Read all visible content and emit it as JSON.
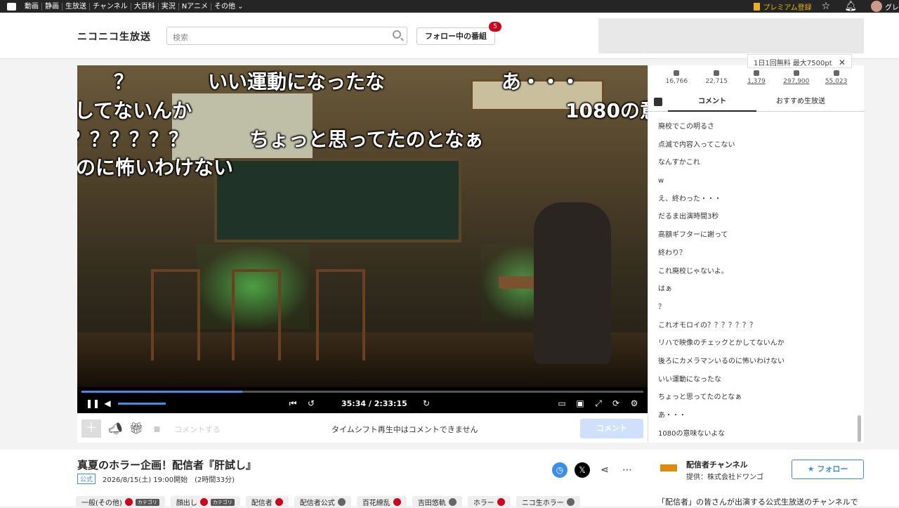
{
  "global_nav": {
    "items": [
      "動画",
      "静画",
      "生放送",
      "チャンネル",
      "大百科",
      "実況",
      "Nアニメ",
      "その他 ⌄"
    ],
    "premium": "プレミアム登録",
    "user": "グレ"
  },
  "header": {
    "logo": "ニコニコ生放送",
    "search_placeholder": "検索",
    "follow_button": "フォロー中の番組",
    "follow_badge": "5"
  },
  "tooltip": {
    "text": "1日1回無料 最大7500pt",
    "close": "✕"
  },
  "stats": [
    {
      "icon": "viewers-icon",
      "value": "16,766"
    },
    {
      "icon": "comments-icon",
      "value": "22,715"
    },
    {
      "icon": "ad-points-icon",
      "value": "1,379"
    },
    {
      "icon": "gift-cannon-icon",
      "value": "297,900"
    },
    {
      "icon": "gift-icon",
      "value": "55,023"
    }
  ],
  "tabs": {
    "comment": "コメント",
    "recommend": "おすすめ生放送"
  },
  "comments": [
    "廃校でこの明るさ",
    "点滅で内容入ってこない",
    "なんすかこれ",
    "w",
    "え、終わった・・・",
    "だるま出演時間3秒",
    "高額ギフターに謝って",
    "終わり？",
    "これ廃校じゃないよ。",
    "はぁ",
    "？",
    "これオモロイの？？？？？？？",
    "リハで映像のチェックとかしてないんか",
    "後ろにカメラマンいるのに怖いわけない",
    "いい運動になったな",
    "ちょっと思ってたのとなぁ",
    "あ・・・",
    "1080の意味ないよな"
  ],
  "danmaku": [
    "？",
    "いい運動になったな",
    "あ・・・",
    "してないんか",
    "1080の意",
    "？？？？？？",
    "ちょっと思ってたのとなぁ",
    "のに怖いわけない"
  ],
  "player": {
    "time": "35:34 / 2:33:15",
    "progress_fraction": 0.286,
    "volume_fraction": 0.5
  },
  "comment_bar": {
    "placeholder": "コメントする",
    "message": "タイムシフト再生中はコメントできません",
    "send": "コメント"
  },
  "program": {
    "title": "真夏のホラー企画！配信者『肝試し』",
    "official": "公式",
    "datetime": "2026/8/15(土) 19:00開始　(2時間33分)",
    "tags": [
      {
        "label": "一般(その他)",
        "cat": "カテゴリ",
        "locked": true
      },
      {
        "label": "顔出し",
        "cat": "カテゴリ",
        "locked": true
      },
      {
        "label": "配信者",
        "cat": "",
        "locked": true
      },
      {
        "label": "配信者公式",
        "cat": "",
        "locked": false
      },
      {
        "label": "百花繚乱",
        "cat": "",
        "locked": true
      },
      {
        "label": "吉田悠軌",
        "cat": "",
        "locked": false
      },
      {
        "label": "ホラー",
        "cat": "",
        "locked": true
      },
      {
        "label": "ニコ生ホラー",
        "cat": "",
        "locked": false
      }
    ]
  },
  "channel": {
    "name": "配信者チャンネル",
    "provider": "提供：株式会社ドワンゴ",
    "follow": "フォロー",
    "description": "「配信者」の皆さんが出演する公式生放送のチャンネルで"
  },
  "colors": {
    "accent": "#3a8ee6",
    "badge": "#d0021b",
    "premium": "#e8b419"
  }
}
